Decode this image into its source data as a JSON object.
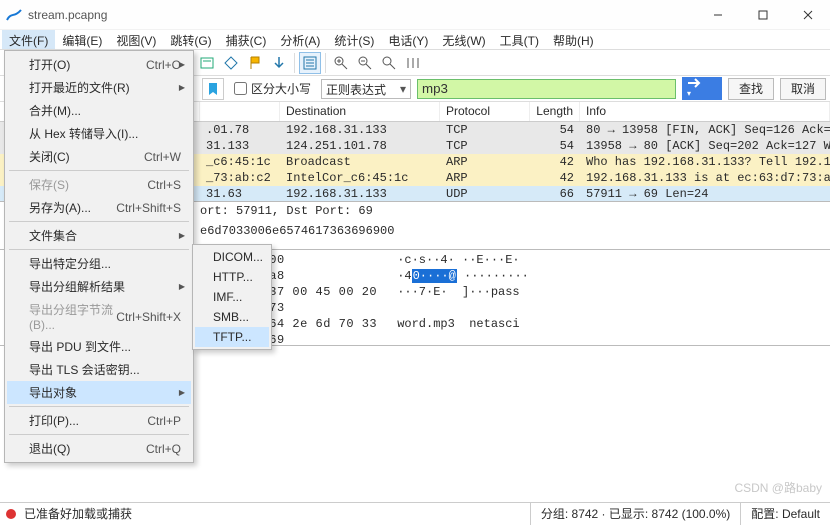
{
  "window": {
    "title": "stream.pcapng"
  },
  "menubar": [
    "文件(F)",
    "编辑(E)",
    "视图(V)",
    "跳转(G)",
    "捕获(C)",
    "分析(A)",
    "统计(S)",
    "电话(Y)",
    "无线(W)",
    "工具(T)",
    "帮助(H)"
  ],
  "file_menu": [
    {
      "label": "打开(O)",
      "shortcut": "Ctrl+O",
      "type": "sub"
    },
    {
      "label": "打开最近的文件(R)",
      "shortcut": "",
      "type": "sub"
    },
    {
      "label": "合并(M)...",
      "shortcut": "",
      "type": ""
    },
    {
      "label": "从 Hex 转储导入(I)...",
      "shortcut": "",
      "type": ""
    },
    {
      "label": "关闭(C)",
      "shortcut": "Ctrl+W",
      "type": ""
    },
    {
      "type": "sep"
    },
    {
      "label": "保存(S)",
      "shortcut": "Ctrl+S",
      "type": "disabled"
    },
    {
      "label": "另存为(A)...",
      "shortcut": "Ctrl+Shift+S",
      "type": ""
    },
    {
      "type": "sep"
    },
    {
      "label": "文件集合",
      "shortcut": "",
      "type": "sub"
    },
    {
      "type": "sep"
    },
    {
      "label": "导出特定分组...",
      "shortcut": "",
      "type": ""
    },
    {
      "label": "导出分组解析结果",
      "shortcut": "",
      "type": "sub"
    },
    {
      "label": "导出分组字节流(B)...",
      "shortcut": "Ctrl+Shift+X",
      "type": "disabled"
    },
    {
      "label": "导出 PDU 到文件...",
      "shortcut": "",
      "type": ""
    },
    {
      "label": "导出 TLS 会话密钥...",
      "shortcut": "",
      "type": ""
    },
    {
      "label": "导出对象",
      "shortcut": "",
      "type": "sub-hl"
    },
    {
      "type": "sep"
    },
    {
      "label": "打印(P)...",
      "shortcut": "Ctrl+P",
      "type": ""
    },
    {
      "type": "sep"
    },
    {
      "label": "退出(Q)",
      "shortcut": "Ctrl+Q",
      "type": ""
    }
  ],
  "export_submenu": [
    "DICOM...",
    "HTTP...",
    "IMF...",
    "SMB...",
    "TFTP..."
  ],
  "submenu_highlight_index": 4,
  "filterbar": {
    "case_label": "区分大小写",
    "mode": "正则表达式",
    "query": "mp3",
    "find": "查找",
    "cancel": "取消"
  },
  "packet_headers": {
    "dst": "Destination",
    "proto": "Protocol",
    "len": "Length",
    "info": "Info"
  },
  "packet_rows": [
    {
      "style": "gray",
      "src": ".01.78",
      "dst": "192.168.31.133",
      "proto": "TCP",
      "len": "54",
      "info": "80 → 13958 [FIN, ACK] Seq=126 Ack=202 Win=30016 Le"
    },
    {
      "style": "gray",
      "src": "31.133",
      "dst": "124.251.101.78",
      "proto": "TCP",
      "len": "54",
      "info": "13958 → 80 [ACK] Seq=202 Ack=127 Win=64115 Len=0"
    },
    {
      "style": "yellow",
      "src": "_c6:45:1c",
      "dst": "Broadcast",
      "proto": "ARP",
      "len": "42",
      "info": "Who has 192.168.31.133? Tell 192.168.31.63"
    },
    {
      "style": "yellow",
      "src": "_73:ab:c2",
      "dst": "IntelCor_c6:45:1c",
      "proto": "ARP",
      "len": "42",
      "info": "192.168.31.133 is at ec:63:d7:73:ab:c2"
    },
    {
      "style": "blue",
      "src": "31.63",
      "dst": "192.168.31.133",
      "proto": "UDP",
      "len": "66",
      "info": "57911 → 69 Len=24"
    }
  ],
  "details": {
    "line1": "ort: 57911, Dst Port: 69",
    "line2": "e6d7033006e6574617363696900"
  },
  "bytes": {
    "lines": [
      {
        "off": "",
        "left_hex": "",
        "hex": "08 00 45 00",
        "asc": " ·c·s··4· ··E···E·"
      },
      {
        "off": "",
        "left_hex": "",
        "hex": "1f 3f c0 a8",
        "asc": " ·4",
        "asc_hl": "0····@",
        "asc3": " ·········"
      },
      {
        "off": "0020",
        "left_hex": "1f 85 e2 37 00 45 00 20",
        "hex": "70 61 73 73",
        "asc": " ···7·E·  ]···pass"
      },
      {
        "off": "0030",
        "left_hex": "77 6f 72 64 2e 6d 70 33",
        "hex": "61 73 63 69",
        "asc": " word.mp3  netasci"
      },
      {
        "off": "0040",
        "left_hex": "69 00",
        "hex": "",
        "asc": " i·"
      }
    ],
    "mid_col": [
      "",
      "",
      "70 61 73 73",
      "61 73 63 69",
      ""
    ]
  },
  "statusbar": {
    "dot_title": "stop-capture",
    "msg": "已准备好加载或捕获",
    "packets": "分组: 8742 · 已显示: 8742 (100.0%)",
    "profile_label": "配置:",
    "profile": "Default"
  },
  "watermark": "CSDN @路baby"
}
